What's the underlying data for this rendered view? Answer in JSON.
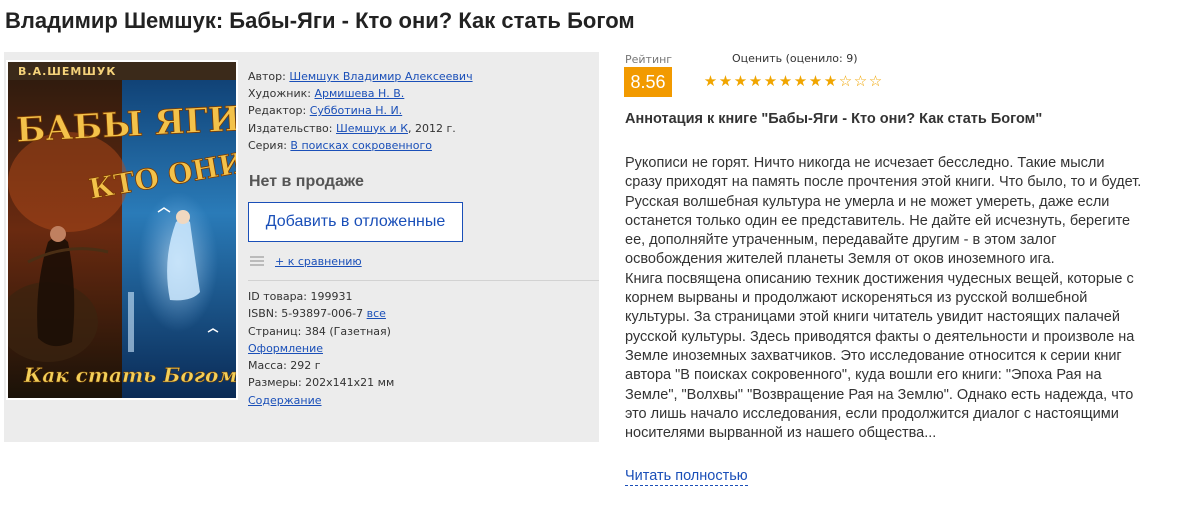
{
  "page": {
    "title": "Владимир Шемшук: Бабы-Яги - Кто они? Как стать Богом"
  },
  "cover": {
    "author_line": "В.А.ШЕМШУК",
    "title_line1": "БАБЫ ЯГИ -",
    "title_line2": "КТО ОНИ?",
    "subtitle": "Как стать Богом"
  },
  "details": {
    "author_label": "Автор:",
    "author_value": "Шемшук Владимир Алексеевич",
    "artist_label": "Художник:",
    "artist_value": "Армишева Н. В.",
    "editor_label": "Редактор:",
    "editor_value": "Субботина Н. И.",
    "publisher_label": "Издательство:",
    "publisher_value": "Шемшук и К",
    "publisher_year": ", 2012 г.",
    "series_label": "Серия:",
    "series_value": "В поисках сокровенного"
  },
  "availability": {
    "status": "Нет в продаже",
    "defer_button": "Добавить в отложенные",
    "compare_link": "+ к сравнению"
  },
  "specs": {
    "id_label": "ID товара:",
    "id_value": "199931",
    "isbn_label": "ISBN:",
    "isbn_value": "5-93897-006-7",
    "isbn_all_link": "все",
    "pages_label": "Страниц:",
    "pages_value": "384 (Газетная)",
    "design_link": "Оформление",
    "mass_label": "Масса:",
    "mass_value": "292 г",
    "size_label": "Размеры:",
    "size_value": "202x141x21 мм",
    "contents_link": "Содержание"
  },
  "rating": {
    "label": "Рейтинг",
    "value": "8.56",
    "rate_label": "Оценить (оценило: 9)",
    "stars_filled": 9,
    "stars_total": 12,
    "star_color": "#f0a500",
    "badge_color": "#f29a00"
  },
  "annotation": {
    "title": "Аннотация к книге \"Бабы-Яги - Кто они? Как стать Богом\"",
    "paragraph1": "Рукописи не горят. Ничто никогда не исчезает бесследно. Такие мысли сразу приходят на память после прочтения этой книги. Что было, то и будет. Русская волшебная культура не умерла и не может умереть, даже если останется только один ее представитель. Не дайте ей исчезнуть, берегите ее, дополняйте утраченным, передавайте другим - в этом залог освобождения жителей планеты Земля от оков иноземного ига.",
    "paragraph2": "Книга посвящена описанию техник достижения чудесных вещей, которые с корнем вырваны и продолжают искореняться из русской волшебной культуры. За страницами этой книги читатель увидит настоящих палачей русской культуры. Здесь приводятся факты о деятельности и произволе на Земле иноземных захватчиков. Это исследование относится к серии книг автора \"В поисках сокровенного\", куда вошли его книги: \"Эпоха Рая на Земле\", \"Волхвы\" \"Возвращение Рая на Землю\". Однако есть надежда, что это лишь начало исследования, если продолжится диалог с настоящими носителями вырванной из нашего общества...",
    "read_more": "Читать полностью"
  },
  "colors": {
    "link": "#1a4fb8",
    "panel_bg": "#ececec"
  }
}
